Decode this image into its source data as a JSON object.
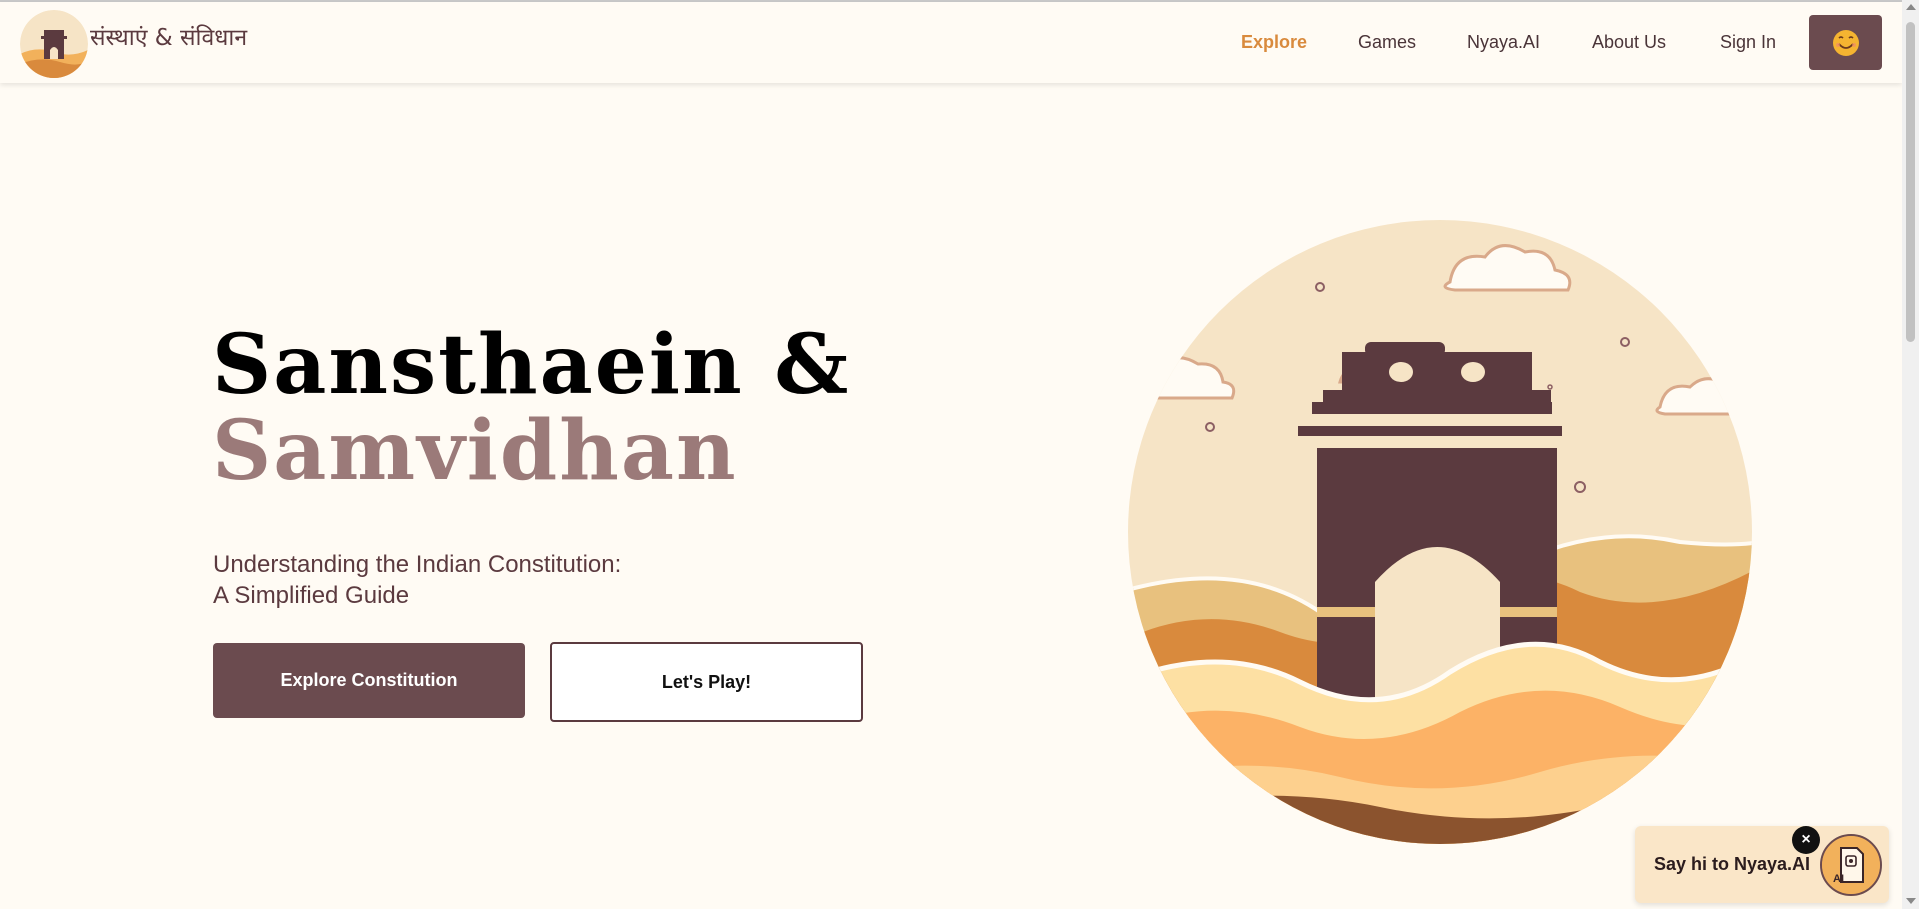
{
  "brand": {
    "name": "संस्थाएं & संविधान",
    "logo_icon": "india-gate-logo-icon"
  },
  "nav": {
    "items": [
      {
        "label": "Explore",
        "active": true
      },
      {
        "label": "Games",
        "active": false
      },
      {
        "label": "Nyaya.AI",
        "active": false
      },
      {
        "label": "About Us",
        "active": false
      },
      {
        "label": "Sign In",
        "active": false
      }
    ],
    "profile_icon": "smiley-face-icon"
  },
  "hero": {
    "title_line1": "Sansthaein &",
    "title_line2": "Samvidhan",
    "subtitle_line1": "Understanding the Indian Constitution:",
    "subtitle_line2": "A Simplified Guide",
    "primary_button": "Explore Constitution",
    "secondary_button": "Let's Play!",
    "illustration_icon": "india-gate-illustration-icon"
  },
  "chat": {
    "prompt": "Say hi to Nyaya.AI",
    "close_label": "×",
    "avatar_icon": "ai-document-icon",
    "avatar_label": "AI"
  },
  "colors": {
    "background": "#fffbf4",
    "primary": "#6b4b4f",
    "accent": "#d98a3d",
    "title_secondary": "#9b7a79",
    "chat_bg": "#fae6c8"
  }
}
